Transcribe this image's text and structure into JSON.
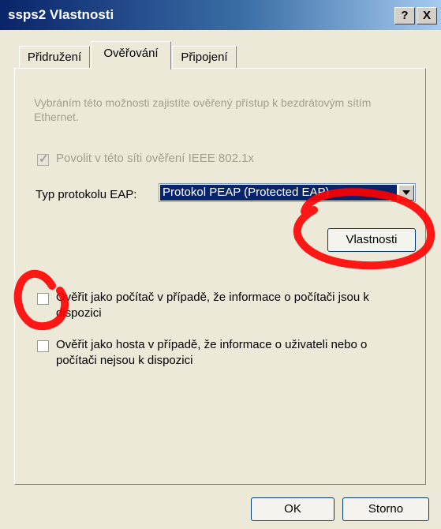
{
  "window": {
    "title": "ssps2 Vlastnosti",
    "help_label": "?",
    "close_label": "X"
  },
  "tabs": [
    {
      "label": "Přidružení",
      "active": false
    },
    {
      "label": "Ověřování",
      "active": true
    },
    {
      "label": "Připojení",
      "active": false
    }
  ],
  "panel": {
    "description": "Vybráním této možnosti zajistíte ověřený přístup k bezdrátovým sítím Ethernet.",
    "enable_8021x": {
      "label": "Povolit v této síti ověření IEEE 802.1x",
      "checked": true,
      "disabled": true
    },
    "eap_label": "Typ protokolu EAP:",
    "eap_selected": "Protokol PEAP (Protected EAP)",
    "properties_button": "Vlastnosti",
    "auth_computer": {
      "label_line1": "Ověřit jako počítač v případě, že informace o počítači jsou k",
      "label_line2": "dispozici",
      "checked": false
    },
    "auth_guest": {
      "label_line1": "Ověřit jako hosta v případě, že informace o uživateli nebo o",
      "label_line2": "počítači nejsou k dispozici",
      "checked": false
    }
  },
  "footer": {
    "ok_label": "OK",
    "cancel_label": "Storno"
  },
  "colors": {
    "annotation": "#ff0000",
    "titlebar": "#0a246a",
    "selection": "#0a246a"
  }
}
